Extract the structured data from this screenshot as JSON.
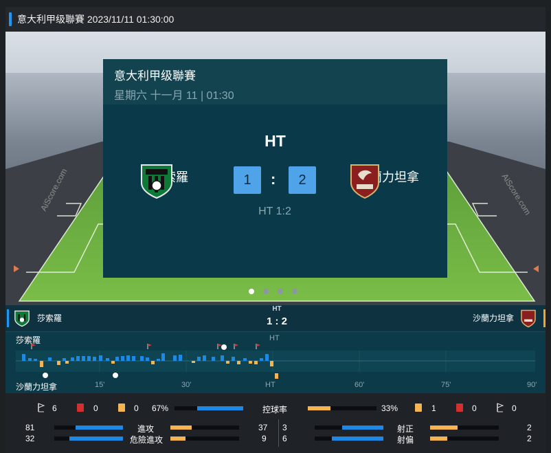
{
  "header": {
    "title": "意大利甲级聯賽 2023/11/11 01:30:00"
  },
  "card": {
    "league": "意大利甲级聯賽",
    "datetime": "星期六 十一月 11 | 01:30",
    "status": "HT",
    "home": {
      "name": "莎索羅",
      "score": "1"
    },
    "away": {
      "name": "沙蘭力坦拿",
      "score": "2"
    },
    "separator": ":",
    "ht_score": "HT 1:2"
  },
  "carousel": {
    "slides": 4,
    "active": 0
  },
  "timeline": {
    "home_name": "莎索羅",
    "away_name": "沙蘭力坦拿",
    "status": "HT",
    "score": "1 : 2",
    "ht_marker": "HT",
    "ticks": [
      "15'",
      "30'",
      "HT",
      "60'",
      "75'",
      "90'"
    ]
  },
  "stats": {
    "home": {
      "corners": "6",
      "red": "0",
      "yellow": "0",
      "possession": "67%"
    },
    "away": {
      "possession": "33%",
      "yellow": "1",
      "red": "0",
      "corners": "0"
    },
    "possession_label": "控球率",
    "possession_home_pct": 67,
    "possession_away_pct": 33,
    "rows_left": [
      {
        "home": "81",
        "label": "進攻",
        "away": "37",
        "home_pct": 69,
        "away_pct": 31
      },
      {
        "home": "32",
        "label": "危險進攻",
        "away": "9",
        "home_pct": 78,
        "away_pct": 22
      }
    ],
    "rows_right": [
      {
        "home": "3",
        "label": "射正",
        "away": "2",
        "home_pct": 60,
        "away_pct": 40
      },
      {
        "home": "6",
        "label": "射偏",
        "away": "2",
        "home_pct": 75,
        "away_pct": 25
      }
    ]
  },
  "colors": {
    "accent": "#2196f3",
    "home": "#1e88e5",
    "away": "#f5b451",
    "yellow": "#f5b451",
    "red": "#d32f2f"
  }
}
